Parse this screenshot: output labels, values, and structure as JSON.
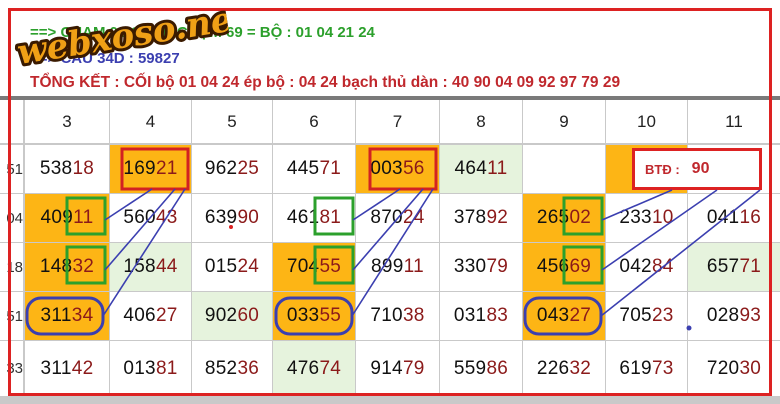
{
  "header": {
    "line1": "==> CHẠM 02 GHÉP CHẠM 69 = BỘ : 01 04 21 24",
    "line2": "==> CẦU 34D : 59827",
    "line3": "TỔNG KẾT : CỐI bộ 01 04 24 ép bộ : 04 24  bạch thủ dàn : 40 90 04 09 92 97 79 29"
  },
  "watermark": "webxoso.net",
  "columns": [
    "3",
    "4",
    "5",
    "6",
    "7",
    "8",
    "9",
    "10",
    "11"
  ],
  "row_labels": [
    "51",
    "04",
    "18",
    "51",
    "33"
  ],
  "rows": [
    [
      "53818",
      "16921",
      "96225",
      "44571",
      "00356",
      "46411",
      "",
      "",
      "BTĐ"
    ],
    [
      "40911",
      "56043",
      "63990",
      "46181",
      "87024",
      "37892",
      "26502",
      "23310",
      "04116"
    ],
    [
      "14832",
      "15844",
      "01524",
      "70455",
      "89911",
      "33079",
      "45669",
      "04284",
      "65771"
    ],
    [
      "31134",
      "40627",
      "90260",
      "03355",
      "71038",
      "03183",
      "04327",
      "70523",
      "02893"
    ],
    [
      "31142",
      "01381",
      "85236",
      "47674",
      "91479",
      "55986",
      "22632",
      "61973",
      "72030"
    ]
  ],
  "btd": {
    "label": "BTĐ :",
    "value": "90"
  },
  "colors": {
    "highlight": "#fdb515",
    "light_green": "#e6f3dd",
    "accent_red": "#d22222",
    "green_box": "#2ca02c",
    "blue_box": "#3b3fb0"
  }
}
